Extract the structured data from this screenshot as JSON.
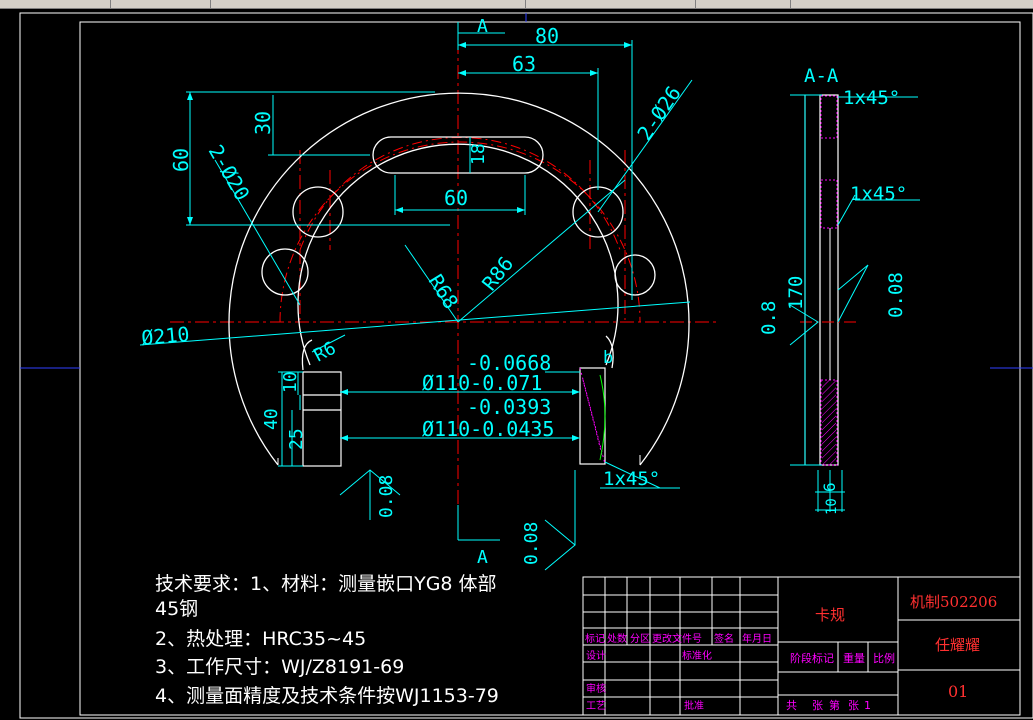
{
  "section": {
    "cut_label_top": "A",
    "cut_label_bottom": "A",
    "view_title": "A-A"
  },
  "dimensions": {
    "d80": "80",
    "d63": "63",
    "d60_vert": "60",
    "d30": "30",
    "d18": "18",
    "d60_horz": "60",
    "holes_26": "2-Ø26",
    "holes_20": "2-Ø20",
    "r86": "R86",
    "r68": "R68",
    "r6": "R6",
    "dia210": "Ø210",
    "tol_upper_1": "-0.0668",
    "dia110_1": "Ø110-0.071",
    "tol_upper_2": "-0.0393",
    "dia110_2": "Ø110-0.0435",
    "small_b": "b",
    "h10": "10",
    "h40": "40",
    "h25": "25",
    "chamfer_1": "1x45°",
    "chamfer_2": "1x45°",
    "chamfer_3": "1x45°",
    "h170": "170",
    "t08": "0.8",
    "t6": "6",
    "t10": "10"
  },
  "roughness": {
    "r_main": "0.08",
    "r_side": "0.08",
    "r_right": "0.8",
    "r_bottom": "0.08"
  },
  "notes": {
    "line1": "技术要求：1、材料：测量嵌口YG8  体部",
    "line2": "45钢",
    "line3": "2、热处理：HRC35~45",
    "line4": "3、工作尺寸：WJ/Z8191-69",
    "line5": "4、测量面精度及技术条件按WJ1153-79"
  },
  "title_block": {
    "part_name": "卡规",
    "drawing_no": "机制502206",
    "designer_name": "任耀耀",
    "sheet": "01",
    "h_biaoji": "标记",
    "h_chushu": "处数",
    "h_fenqu": "分区",
    "h_gengai": "更改文件号",
    "h_qianming": "签名",
    "h_nianyueri": "年月日",
    "h_sheji": "设计",
    "h_biaozhunhua": "标准化",
    "h_jieduan": "阶段标记",
    "h_zhongliang": "重量",
    "h_bili": "比例",
    "h_shenhe": "审核",
    "h_gongyi": "工艺",
    "h_pizhun": "批准",
    "h_gong": "共",
    "h_zhang": "张",
    "h_di": "第",
    "h_zhang2": "张",
    "h_one": "1"
  }
}
